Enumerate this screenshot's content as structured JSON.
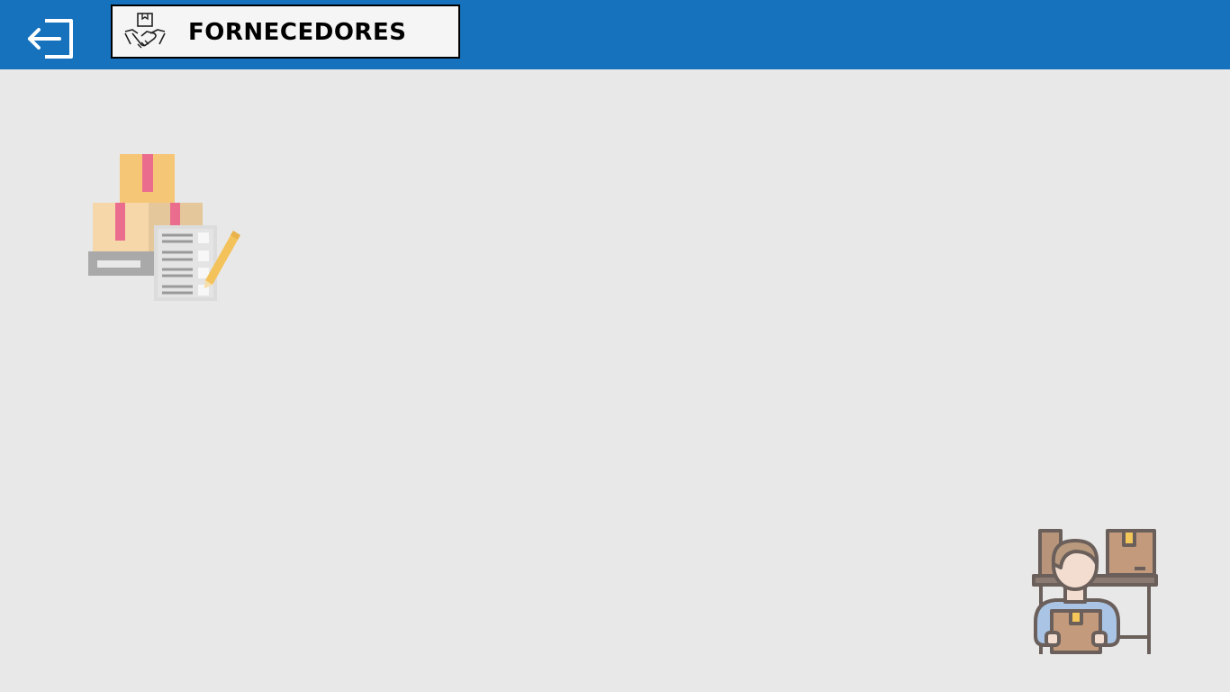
{
  "header": {
    "title": "FORNECEDORES",
    "background_color": "#1672bd",
    "back_icon": "logout-arrow-icon",
    "title_icon": "handshake-box-icon"
  },
  "main": {
    "background_color": "#e8e8e8",
    "illustrations": [
      "boxes-checklist-icon",
      "warehouse-worker-icon"
    ]
  }
}
